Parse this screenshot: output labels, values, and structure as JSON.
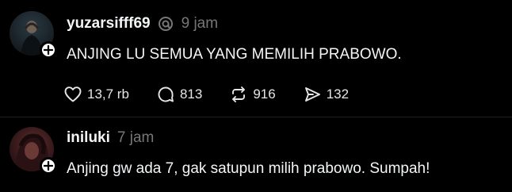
{
  "posts": [
    {
      "username": "yuzarsifff69",
      "timestamp": "9 jam",
      "text": "ANJING LU SEMUA YANG MEMILIH PRABOWO.",
      "likes": "13,7 rb",
      "replies": "813",
      "reposts": "916",
      "shares": "132"
    },
    {
      "username": "iniluki",
      "timestamp": "7 jam",
      "text": "Anjing gw ada 7, gak satupun milih prabowo. Sumpah!"
    }
  ],
  "icons": {
    "verified": "threads-thread-icon",
    "like": "heart-icon",
    "reply": "speech-bubble-icon",
    "repost": "repost-arrows-icon",
    "share": "send-icon",
    "follow": "plus-icon"
  },
  "colors": {
    "background": "#000000",
    "text": "#f3f5f7",
    "muted": "#777777"
  }
}
